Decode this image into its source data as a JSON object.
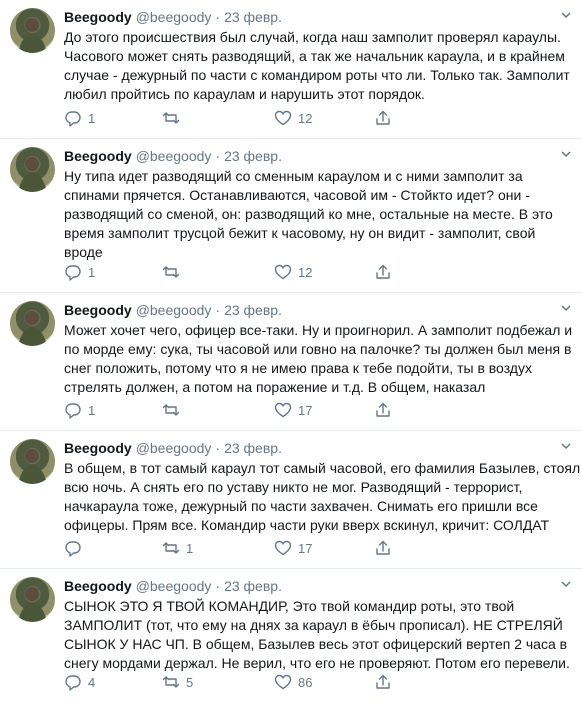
{
  "tweets": [
    {
      "author": "Beegoody",
      "handle": "@beegoody",
      "separator": "·",
      "date": "23 февр.",
      "lines": [
        "До этого происшествия был случай, когда наш замполит проверял караулы.",
        "Часового может снять разводящий, а так же начальник караула, и в крайнем",
        "случае - дежурный по части с командиром роты что ли. Только так. Замполит",
        "любил пройтись по караулам и нарушить этот порядок."
      ],
      "replies": "1",
      "retweets": "",
      "likes": "12"
    },
    {
      "author": "Beegoody",
      "handle": "@beegoody",
      "separator": "·",
      "date": "23 февр.",
      "lines": [
        "Ну типа идет разводящий со сменным караулом и с ними замполит за",
        "спинами прячется. Останавливаются, часовой им - Стойкто идет? они -",
        "разводящий со сменой, он: разводящий ко мне, остальные на месте. В это",
        "время замполит трусцой бежит к часовому, ну он видит - замполит, свой",
        "вроде"
      ],
      "replies": "1",
      "retweets": "",
      "likes": "12"
    },
    {
      "author": "Beegoody",
      "handle": "@beegoody",
      "separator": "·",
      "date": "23 февр.",
      "lines": [
        "Может хочет чего, офицер все-таки. Ну и проигнорил. А замполит подбежал и",
        "по морде ему: сука, ты часовой или говно на палочке? ты должен был меня в",
        "снег  положить, потому что я не имею права к тебе подойти, ты в воздух",
        "стрелять должен, а потом на поражение и т.д. В общем, наказал"
      ],
      "replies": "1",
      "retweets": "",
      "likes": "17"
    },
    {
      "author": "Beegoody",
      "handle": "@beegoody",
      "separator": "·",
      "date": "23 февр.",
      "lines": [
        "В общем, в тот самый караул тот самый часовой, его фамилия Базылев, стоял",
        "всю ночь. А снять его по уставу никто не мог. Разводящий - террорист,",
        "начкараула тоже, дежурный по части захвачен. Снимать его пришли все",
        "офицеры. Прям все. Командир части руки вверх вскинул, кричит: СОЛДАТ"
      ],
      "replies": "",
      "retweets": "1",
      "likes": "17"
    },
    {
      "author": "Beegoody",
      "handle": "@beegoody",
      "separator": "·",
      "date": "23 февр.",
      "lines": [
        "СЫНОК ЭТО Я ТВОЙ КОМАНДИР, Это твой командир роты, это твой",
        "ЗАМПОЛИТ (тот, что ему на днях за караул в ёбыч прописал). НЕ СТРЕЛЯЙ",
        "СЫНОК У НАС ЧП. В общем, Базылев весь этот офицерский вертеп 2 часа в",
        "снегу мордами держал. Не верил, что его не проверяют. Потом его перевели."
      ],
      "replies": "4",
      "retweets": "5",
      "likes": "86"
    }
  ],
  "icons": {
    "reply": "reply-icon",
    "retweet": "retweet-icon",
    "like": "heart-icon",
    "share": "share-icon",
    "more": "chevron-down-icon"
  },
  "colors": {
    "text": "#14171a",
    "secondary": "#657786",
    "divider": "#e6ecf0"
  }
}
